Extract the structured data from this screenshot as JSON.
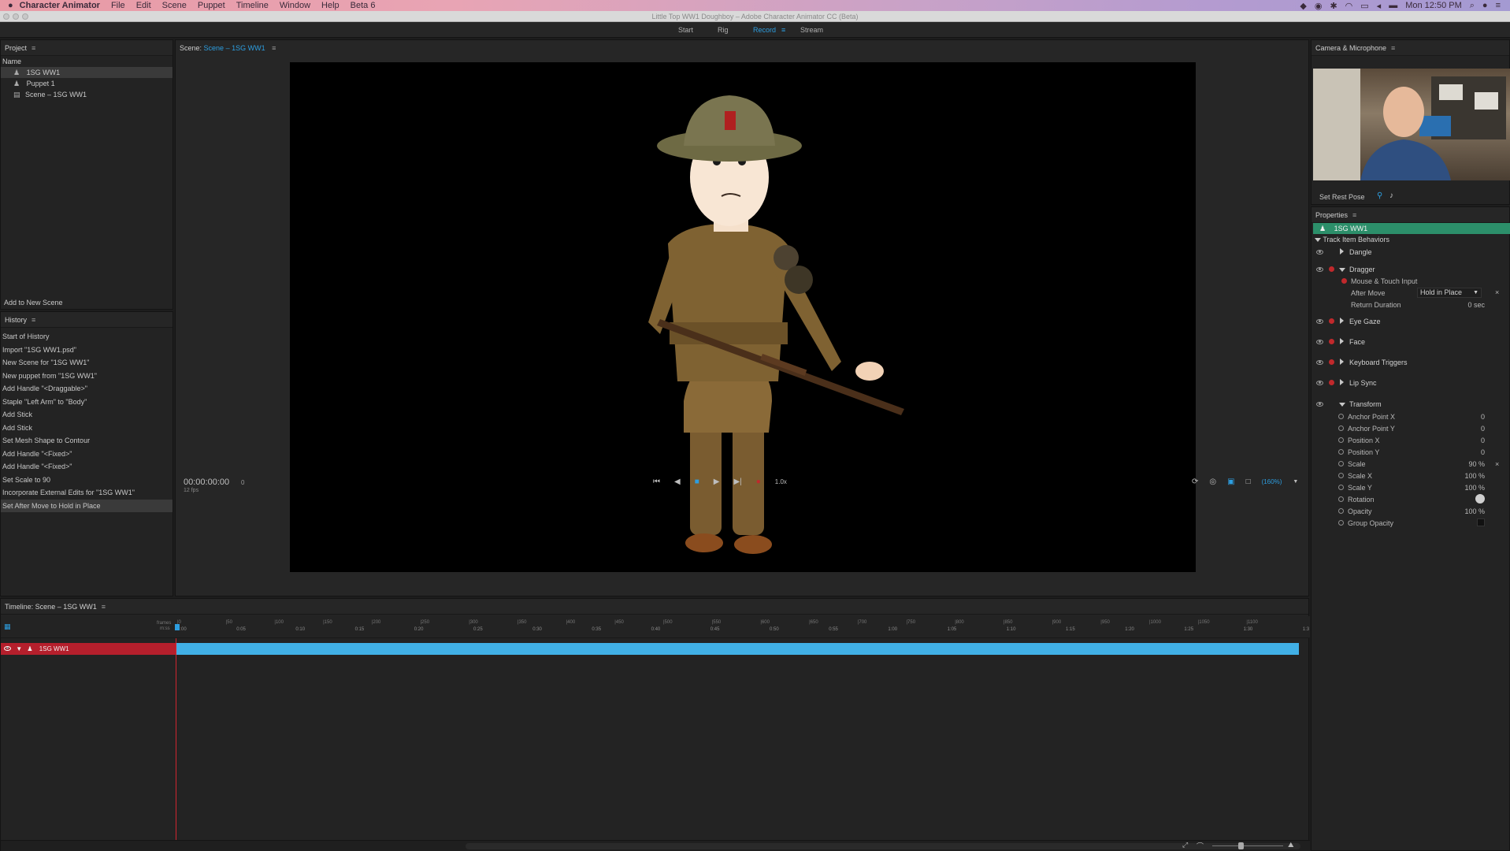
{
  "menubar": {
    "app_name": "Character Animator",
    "items": [
      "File",
      "Edit",
      "Scene",
      "Puppet",
      "Timeline",
      "Window",
      "Help",
      "Beta 6"
    ],
    "clock": "Mon 12:50 PM"
  },
  "window": {
    "title": "Little Top WW1 Doughboy – Adobe Character Animator CC (Beta)"
  },
  "workspace": {
    "tabs": [
      "Start",
      "Rig",
      "Record",
      "Stream"
    ],
    "active": "Record"
  },
  "project": {
    "title": "Project",
    "column": "Name",
    "items": [
      "1SG WW1",
      "Puppet 1",
      "Scene – 1SG WW1"
    ],
    "add_button": "Add to New Scene"
  },
  "history": {
    "title": "History",
    "items": [
      "Start of History",
      "Import \"1SG WW1.psd\"",
      "New Scene for \"1SG WW1\"",
      "New puppet from \"1SG WW1\"",
      "Add Handle \"<Draggable>\"",
      "Staple \"Left Arm\" to \"Body\"",
      "Add Stick",
      "Add Stick",
      "Set Mesh Shape to Contour",
      "Add Handle \"<Fixed>\"",
      "Add Handle \"<Fixed>\"",
      "Set Scale to 90",
      "Incorporate External Edits for \"1SG WW1\"",
      "Set After Move to Hold in Place"
    ]
  },
  "scene": {
    "label": "Scene:",
    "name": "Scene – 1SG WW1",
    "timecode": "00:00:00:00",
    "frame": "0",
    "fps": "12 fps",
    "speed": "1.0x",
    "zoom": "(160%)"
  },
  "camera": {
    "title": "Camera & Microphone",
    "rest_pose": "Set Rest Pose"
  },
  "properties": {
    "title": "Properties",
    "puppet": "1SG WW1",
    "section": "Track Item Behaviors",
    "behaviors": [
      "Dangle",
      "Dragger",
      "Eye Gaze",
      "Face",
      "Keyboard Triggers",
      "Lip Sync",
      "Transform"
    ],
    "dragger": {
      "mouse": "Mouse & Touch Input",
      "after_move": "After Move",
      "after_move_value": "Hold in Place",
      "return_duration": "Return Duration",
      "return_duration_value": "0 sec"
    },
    "transform": [
      {
        "label": "Anchor Point X",
        "value": "0"
      },
      {
        "label": "Anchor Point Y",
        "value": "0"
      },
      {
        "label": "Position X",
        "value": "0"
      },
      {
        "label": "Position Y",
        "value": "0"
      },
      {
        "label": "Scale",
        "value": "90 %"
      },
      {
        "label": "Scale X",
        "value": "100 %"
      },
      {
        "label": "Scale Y",
        "value": "100 %"
      },
      {
        "label": "Rotation",
        "value": ""
      },
      {
        "label": "Opacity",
        "value": "100 %"
      },
      {
        "label": "Group Opacity",
        "value": ""
      }
    ]
  },
  "timeline": {
    "title": "Timeline: Scene – 1SG WW1",
    "frames_label": "frames",
    "time_label": "m:ss",
    "track_name": "1SG WW1",
    "frame_ticks": [
      "0",
      "50",
      "100",
      "150",
      "200",
      "250",
      "300",
      "350",
      "400",
      "450",
      "500",
      "550",
      "600",
      "650",
      "700",
      "750",
      "800",
      "850",
      "900",
      "950",
      "1000",
      "1050",
      "1100"
    ],
    "time_ticks": [
      "0:00",
      "0:05",
      "0:10",
      "0:15",
      "0:20",
      "0:25",
      "0:30",
      "0:35",
      "0:40",
      "0:45",
      "0:50",
      "0:55",
      "1:00",
      "1:05",
      "1:10",
      "1:15",
      "1:20",
      "1:25",
      "1:30",
      "1:3"
    ]
  }
}
